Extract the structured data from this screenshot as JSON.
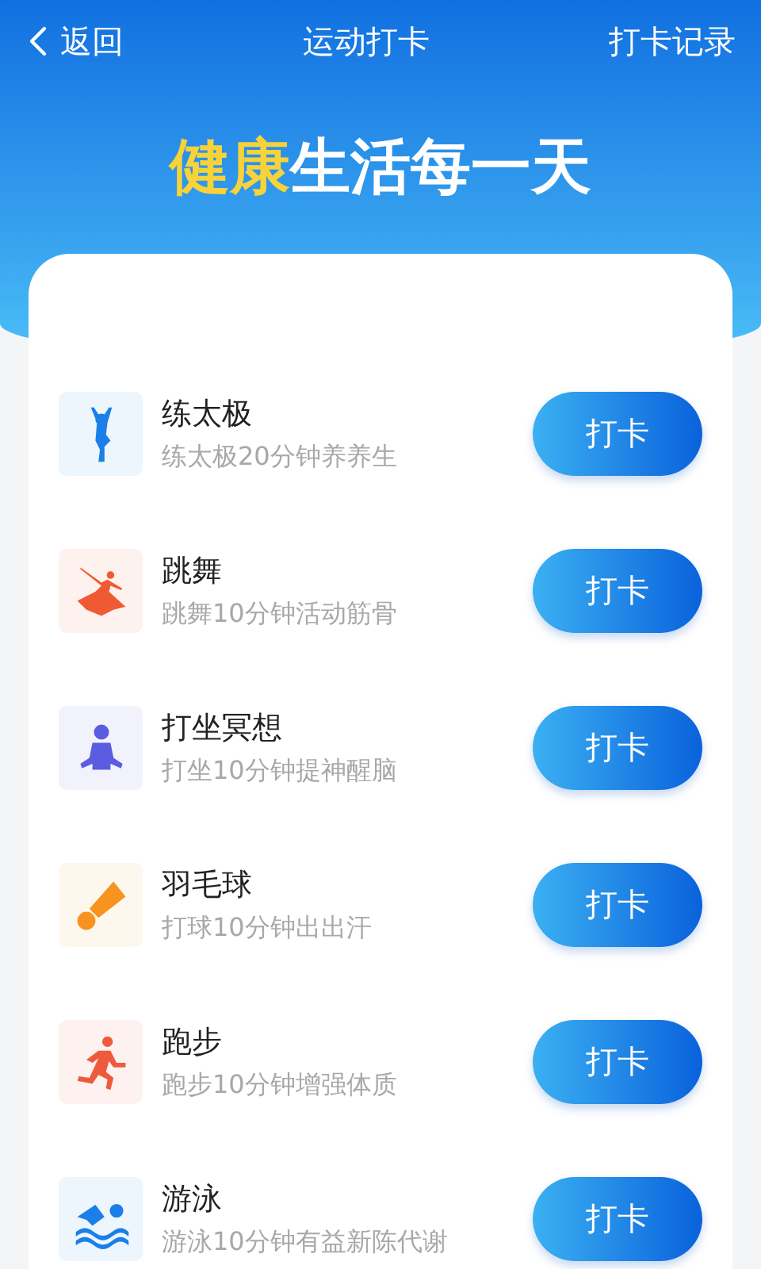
{
  "nav": {
    "back": "返回",
    "title": "运动打卡",
    "action": "打卡记录"
  },
  "headline": {
    "highlight": "健康",
    "rest": "生活每一天"
  },
  "activities": [
    {
      "kind": "taichi",
      "color": "#1a7fe8",
      "name": "练太极",
      "desc": "练太极20分钟养养生",
      "button": "打卡"
    },
    {
      "kind": "dance",
      "color": "#f05a32",
      "name": "跳舞",
      "desc": "跳舞10分钟活动筋骨",
      "button": "打卡"
    },
    {
      "kind": "meditate",
      "color": "#5a5de0",
      "name": "打坐冥想",
      "desc": "打坐10分钟提神醒脑",
      "button": "打卡"
    },
    {
      "kind": "badminton",
      "color": "#f7931e",
      "name": "羽毛球",
      "desc": "打球10分钟出出汗",
      "button": "打卡"
    },
    {
      "kind": "run",
      "color": "#ee5a3c",
      "name": "跑步",
      "desc": "跑步10分钟增强体质",
      "button": "打卡"
    },
    {
      "kind": "swim",
      "color": "#1a7fe8",
      "name": "游泳",
      "desc": "游泳10分钟有益新陈代谢",
      "button": "打卡"
    }
  ]
}
